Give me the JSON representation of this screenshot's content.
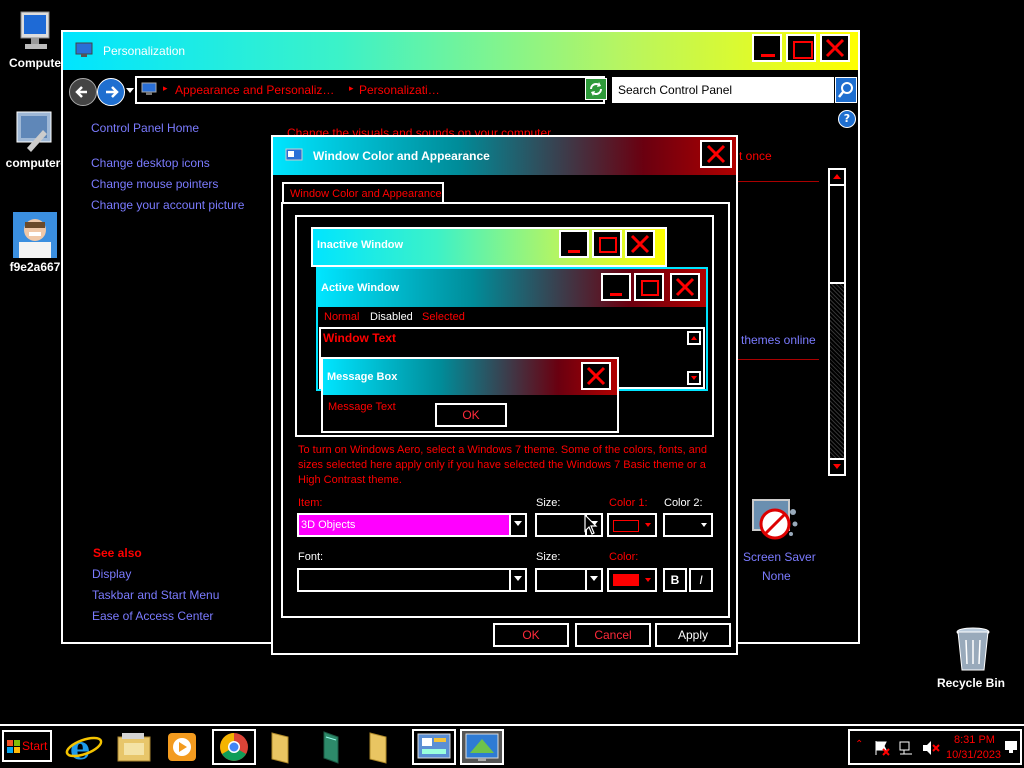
{
  "desktop": {
    "icons": [
      {
        "label": "Compute"
      },
      {
        "label": "computer-"
      },
      {
        "label": "f9e2a667"
      },
      {
        "label": "Recycle Bin"
      }
    ]
  },
  "personalization": {
    "title": "Personalization",
    "breadcrumb_1": "Appearance and Personaliz…",
    "breadcrumb_2": "Personalizati…",
    "search_placeholder": "Search Control Panel",
    "left_links": [
      "Control Panel Home",
      "Change desktop icons",
      "Change mouse pointers",
      "Change your account picture"
    ],
    "heading": "Change the visuals and sounds on your computer",
    "once_text": "t once",
    "themes_online": "themes online",
    "see_also_title": "See also",
    "see_also": [
      "Display",
      "Taskbar and Start Menu",
      "Ease of Access Center"
    ],
    "screensaver_label": "Screen Saver",
    "screensaver_value": "None"
  },
  "dialog": {
    "title": "Window Color and Appearance",
    "tab": "Window Color and Appearance",
    "preview": {
      "inactive": "Inactive Window",
      "active": "Active Window",
      "menu_normal": "Normal",
      "menu_disabled": "Disabled",
      "menu_selected": "Selected",
      "window_text": "Window Text",
      "message_box": "Message Box",
      "message_text": "Message Text",
      "ok": "OK"
    },
    "note": "To turn on Windows Aero, select a Windows 7 theme.  Some of the colors, fonts, and sizes selected here apply only if you have selected the Windows 7 Basic theme or a High Contrast theme.",
    "item_label": "Item:",
    "item_value": "3D Objects",
    "size_label": "Size:",
    "color1_label": "Color 1:",
    "color2_label": "Color 2:",
    "font_label": "Font:",
    "font_size_label": "Size:",
    "color_label": "Color:",
    "bold": "B",
    "italic": "I",
    "ok": "OK",
    "cancel": "Cancel",
    "apply": "Apply",
    "colors": {
      "item_highlight": "#ff00ff",
      "font_color": "#ff0000"
    }
  },
  "taskbar": {
    "start": "Start",
    "time": "8:31 PM",
    "date": "10/31/2023"
  }
}
